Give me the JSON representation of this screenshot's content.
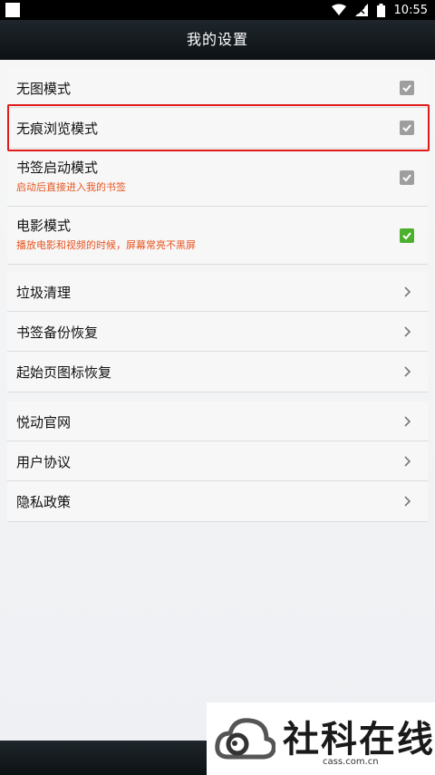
{
  "status_bar": {
    "time": "10:55"
  },
  "header": {
    "title": "我的设置"
  },
  "settings_group_1": [
    {
      "label": "无图模式",
      "checked": false
    },
    {
      "label": "无痕浏览模式",
      "checked": false
    },
    {
      "label": "书签启动模式",
      "sub": "启动后直接进入我的书签",
      "checked": false
    },
    {
      "label": "电影模式",
      "sub": "播放电影和视频的时候，屏幕常亮不黑屏",
      "checked": true
    }
  ],
  "settings_group_2": [
    {
      "label": "垃圾清理"
    },
    {
      "label": "书签备份恢复"
    },
    {
      "label": "起始页图标恢复"
    }
  ],
  "settings_group_3": [
    {
      "label": "悦动官网"
    },
    {
      "label": "用户协议"
    },
    {
      "label": "隐私政策"
    }
  ],
  "watermark": {
    "text": "社科在线",
    "url": "cass.com.cn"
  },
  "colors": {
    "header_bg": "#12191d",
    "checkbox_off": "#9e9e9e",
    "checkbox_on": "#4cb02e",
    "subtitle": "#e8541f",
    "highlight": "#e01b1b"
  }
}
